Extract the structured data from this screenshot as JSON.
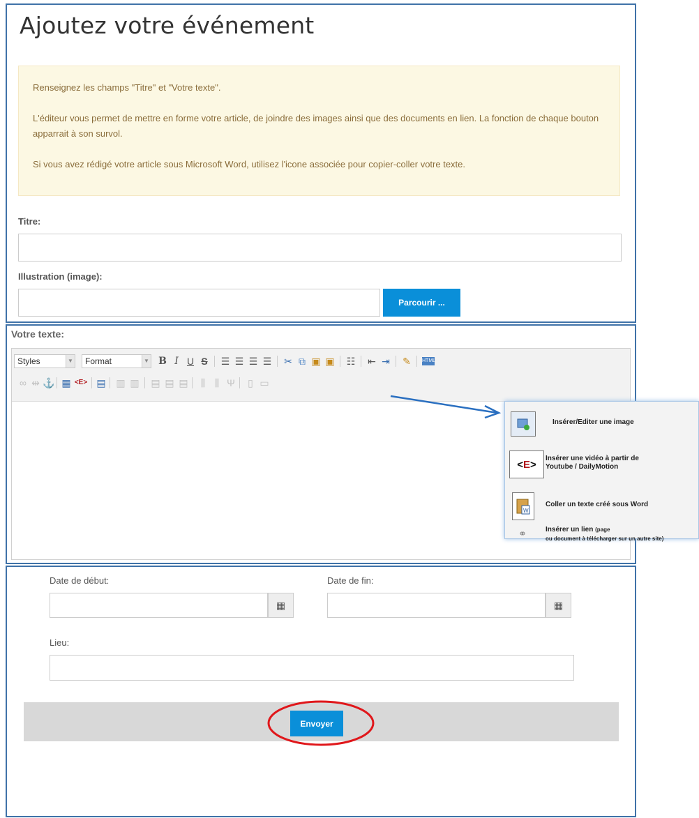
{
  "page": {
    "title": "Ajoutez votre événement",
    "notice": [
      "Renseignez les champs \"Titre\" et \"Votre texte\".",
      "L'éditeur vous permet de mettre en forme votre article, de joindre des images ainsi que des documents en lien. La fonction de chaque bouton apparrait à son survol.",
      "Si vous avez rédigé votre article sous Microsoft Word, utilisez l'icone associée pour copier-coller votre texte."
    ]
  },
  "form": {
    "title_label": "Titre:",
    "title_value": "",
    "illustration_label": "Illustration (image):",
    "illustration_value": "",
    "browse_label": "Parcourir ...",
    "text_label": "Votre texte:",
    "start_label": "Date de début:",
    "start_value": "",
    "end_label": "Date de fin:",
    "end_value": "",
    "place_label": "Lieu:",
    "place_value": "",
    "submit_label": "Envoyer"
  },
  "editor": {
    "styles_select": "Styles",
    "format_select": "Format"
  },
  "callout": {
    "image_text": "Insérer/Editer une image",
    "video_text_1": "Insérer une vidéo à partir de",
    "video_text_2": "Youtube / DailyMotion",
    "word_text": "Coller un texte créé sous Word",
    "link_text": "Insérer un lien",
    "link_small_1": "(page",
    "link_small_2": "ou document à télécharger sur un autre site)"
  },
  "colors": {
    "frame_border": "#3f72a8",
    "accent_button": "#0a8fd9",
    "notice_bg": "#fcf8e3",
    "notice_text": "#8a6d3b",
    "annotation_red": "#e0171b",
    "arrow_blue": "#2a6fc0"
  }
}
